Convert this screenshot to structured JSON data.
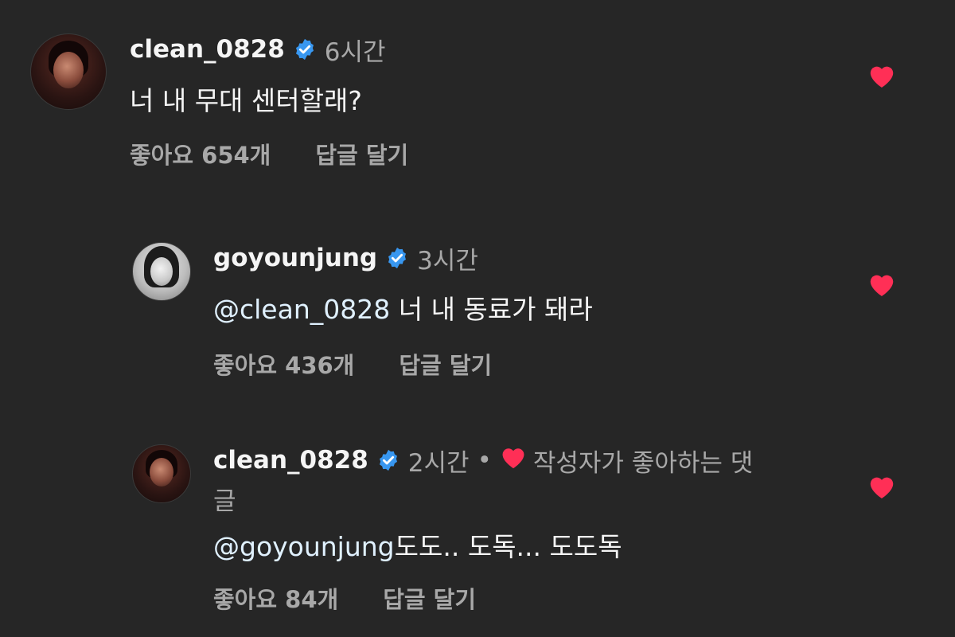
{
  "colors": {
    "background": "#262626",
    "heart": "#ff2f56",
    "verified": "#3897f0",
    "mention": "#e0f1ff",
    "secondary": "#a8a8a8"
  },
  "comments": [
    {
      "username": "clean_0828",
      "time": "6시간",
      "text": "너 내 무대 센터할래?",
      "likes": "좋아요 654개",
      "reply_label": "답글 달기",
      "liked": true
    },
    {
      "username": "goyounjung",
      "time": "3시간",
      "mention": "@clean_0828",
      "text": " 너 내 동료가 돼라",
      "likes": "좋아요 436개",
      "reply_label": "답글 달기",
      "liked": true
    },
    {
      "username": "clean_0828",
      "time": "2시간",
      "dot": "•",
      "author_liked_label": "작성자가 좋아하는 댓",
      "author_liked_wrap": "글",
      "mention": "@goyounjung",
      "text": "도도.. 도독... 도도독",
      "likes": "좋아요 84개",
      "reply_label": "답글 달기",
      "liked": true
    }
  ]
}
